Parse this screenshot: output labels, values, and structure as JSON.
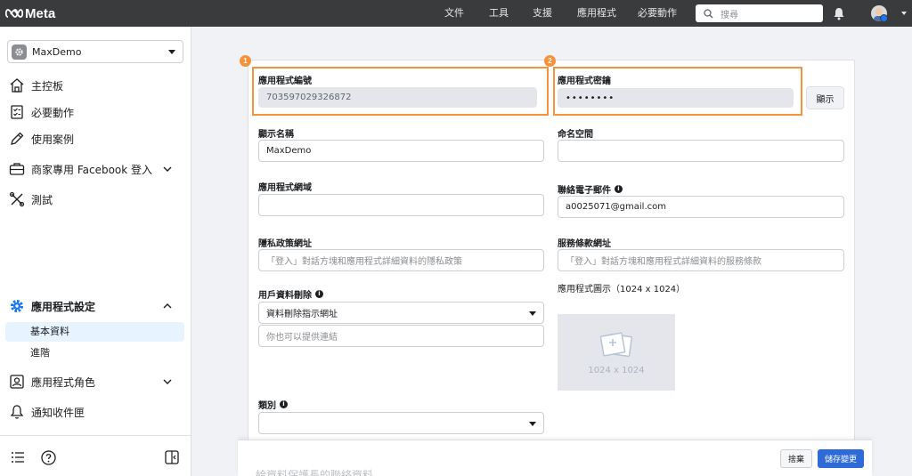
{
  "topbar": {
    "logo_text": "Meta",
    "nav": [
      "文件",
      "工具",
      "支援",
      "應用程式",
      "必要動作"
    ],
    "search_placeholder": "搜尋"
  },
  "sidebar": {
    "app_name": "MaxDemo",
    "items": [
      {
        "label": "主控板",
        "icon": "home-icon"
      },
      {
        "label": "必要動作",
        "icon": "checklist-icon"
      },
      {
        "label": "使用案例",
        "icon": "pencil-icon"
      },
      {
        "label": "商家專用 Facebook 登入",
        "icon": "briefcase-icon"
      },
      {
        "label": "測試",
        "icon": "tools-icon"
      }
    ],
    "settings": {
      "label": "應用程式設定",
      "sub": [
        "基本資料",
        "進階"
      ]
    },
    "roles": "應用程式角色",
    "inbox": "通知收件匣"
  },
  "form": {
    "app_id_label": "應用程式編號",
    "app_id": "703597029326872",
    "app_secret_label": "應用程式密鑰",
    "app_secret": "••••••••",
    "show_button": "顯示",
    "display_name_label": "顯示名稱",
    "display_name": "MaxDemo",
    "namespace_label": "命名空間",
    "app_domain_label": "應用程式網域",
    "contact_email_label": "聯絡電子郵件",
    "contact_email": "a0025071@gmail.com",
    "privacy_label": "隱私政策網址",
    "privacy_placeholder": "「登入」對話方塊和應用程式詳細資料的隱私政策",
    "tos_label": "服務條款網址",
    "tos_placeholder": "「登入」對話方塊和應用程式詳細資料的服務條款",
    "data_deletion_label": "用戶資料刪除",
    "data_deletion_select": "資料刪除指示網址",
    "data_deletion_placeholder": "你也可以提供連結",
    "app_icon_label": "應用程式圖示（1024 x 1024）",
    "app_icon_size": "1024 x 1024",
    "category_label": "類別"
  },
  "badges": [
    "1",
    "2"
  ],
  "footer": {
    "faded_text": "給資料保護長的聯絡資料",
    "discard": "捨棄",
    "save": "儲存變更"
  },
  "colors": {
    "highlight": "#f7923a",
    "primary": "#2f6bd8",
    "topbar": "#3a3b3c"
  }
}
